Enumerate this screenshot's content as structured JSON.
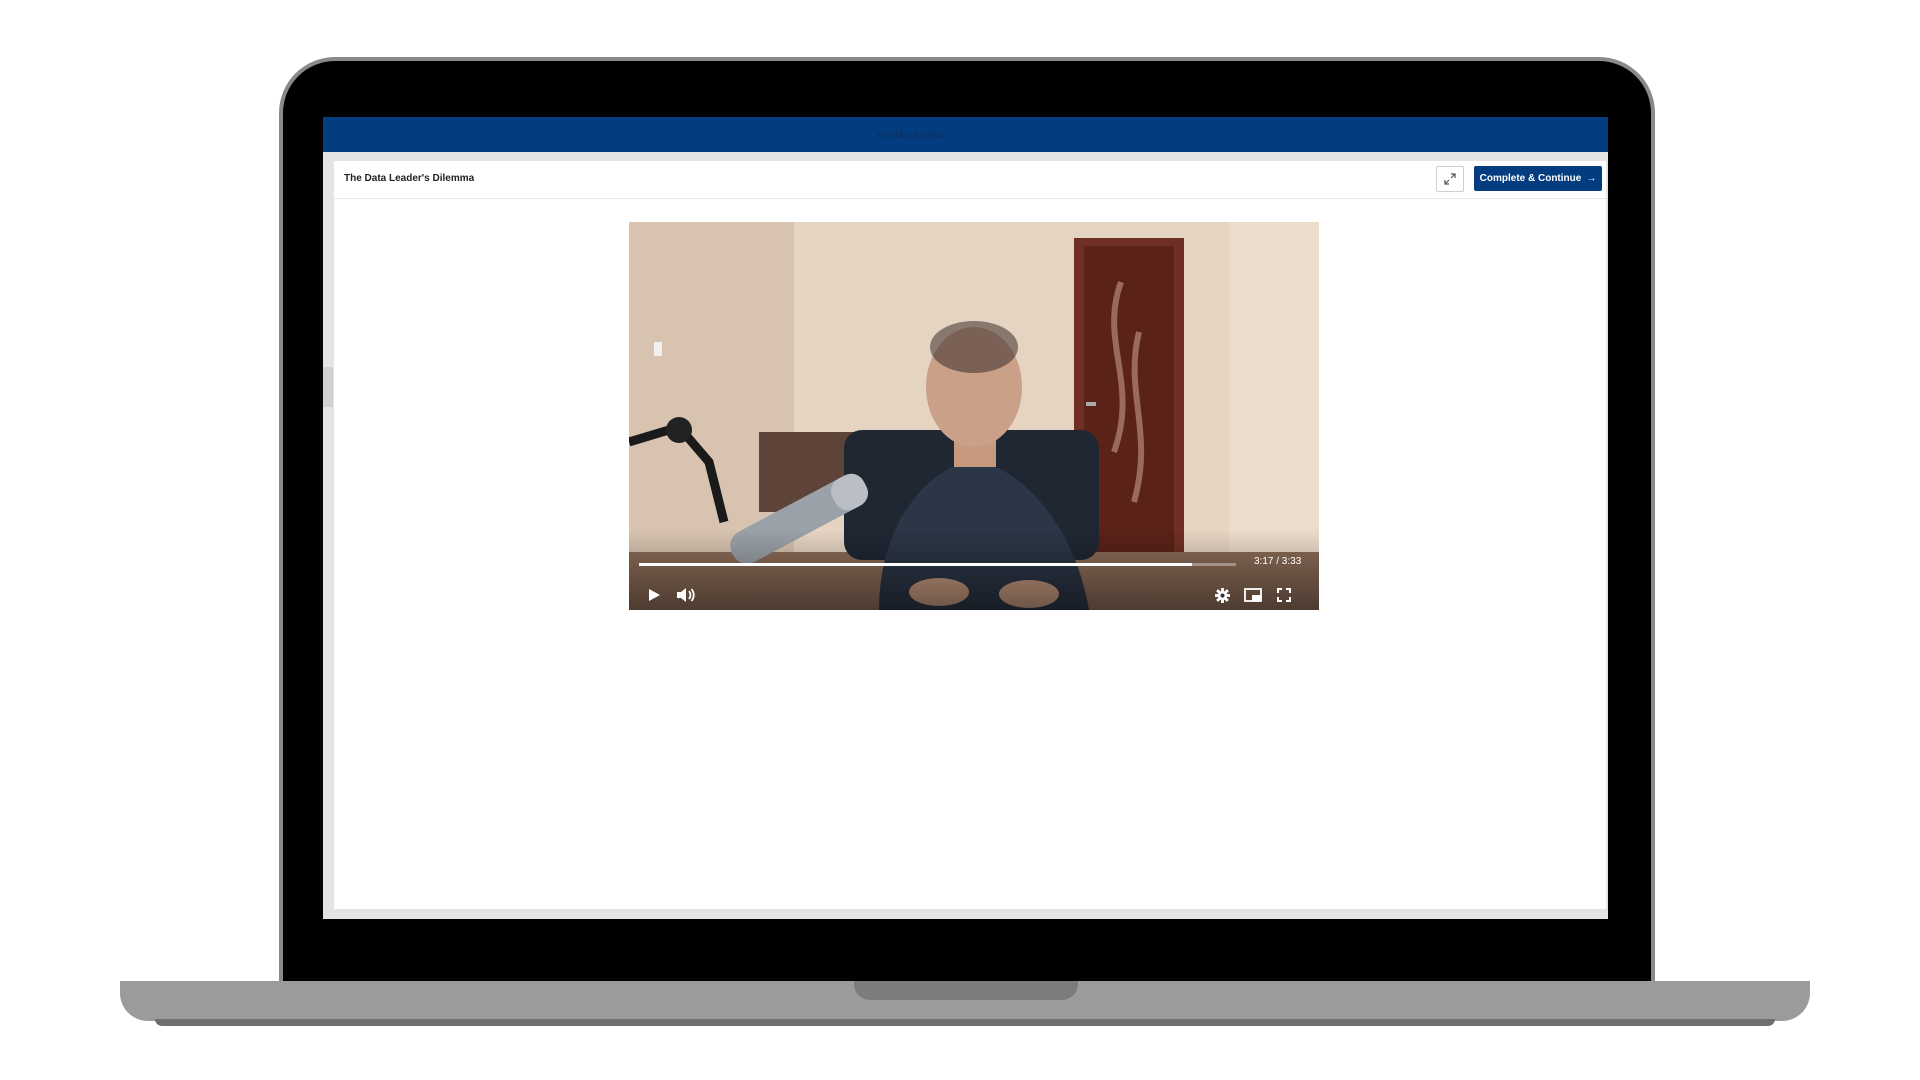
{
  "top_bar": {
    "user_name": "Yordan Ivanov"
  },
  "lesson": {
    "title": "The Data Leader's Dilemma",
    "complete_label": "Complete & Continue",
    "complete_arrow": "→"
  },
  "player": {
    "time_display": "3:17 / 3:33",
    "progress": 0.926,
    "controls": [
      "play-icon",
      "volume-icon",
      "settings-icon",
      "picture-in-picture-icon",
      "fullscreen-icon"
    ]
  },
  "colors": {
    "brand": "#033d80",
    "header_bg": "#033d80"
  }
}
